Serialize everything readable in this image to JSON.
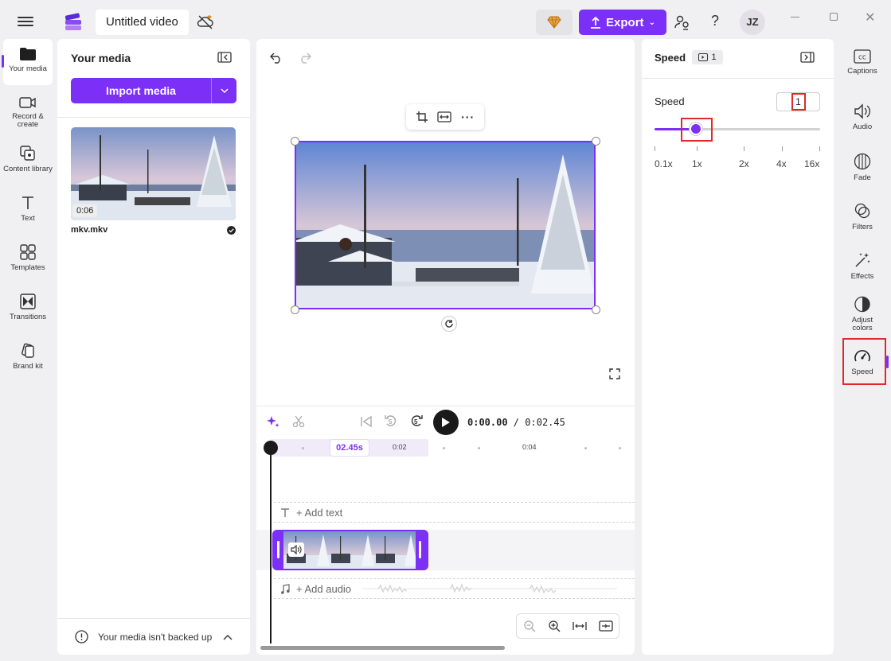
{
  "app": {
    "project_title": "Untitled video",
    "export_label": "Export",
    "help_label": "?",
    "avatar_initials": "JZ",
    "accent_color": "#7b2ff7",
    "highlight_color": "#e02a2a"
  },
  "left_rail": {
    "items": [
      {
        "label": "Your media",
        "icon": "folder-icon"
      },
      {
        "label": "Record & create",
        "icon": "camera-icon"
      },
      {
        "label": "Content library",
        "icon": "content-library-icon"
      },
      {
        "label": "Text",
        "icon": "text-icon"
      },
      {
        "label": "Templates",
        "icon": "templates-icon"
      },
      {
        "label": "Transitions",
        "icon": "transitions-icon"
      },
      {
        "label": "Brand kit",
        "icon": "brand-kit-icon"
      }
    ]
  },
  "media": {
    "title": "Your media",
    "import_label": "Import media",
    "items": [
      {
        "name": "mkv.mkv",
        "duration": "0:06"
      }
    ],
    "backup_text": "Your media isn't backed up"
  },
  "timeline": {
    "timecode_current": "0:00.00",
    "timecode_sep": " / ",
    "timecode_total": "0:02.45",
    "ruler_pill": "02.45s",
    "ruler_marks": [
      "0:02",
      "0:04"
    ],
    "add_text": "+ Add text",
    "add_audio": "+ Add audio",
    "skip_back": "5",
    "skip_forward": "5"
  },
  "speed_panel": {
    "title": "Speed",
    "badge_count": "1",
    "speed_label": "Speed",
    "speed_value": "1",
    "slider_fraction": 0.25,
    "tick_labels": [
      "0.1x",
      "1x",
      "2x",
      "4x",
      "16x"
    ]
  },
  "right_rail": {
    "items": [
      {
        "label": "Captions",
        "icon": "captions-icon"
      },
      {
        "label": "Audio",
        "icon": "audio-icon"
      },
      {
        "label": "Fade",
        "icon": "fade-icon"
      },
      {
        "label": "Filters",
        "icon": "filters-icon"
      },
      {
        "label": "Effects",
        "icon": "effects-icon"
      },
      {
        "label": "Adjust colors",
        "icon": "adjust-colors-icon"
      },
      {
        "label": "Speed",
        "icon": "speed-icon"
      }
    ],
    "active": "Speed"
  }
}
